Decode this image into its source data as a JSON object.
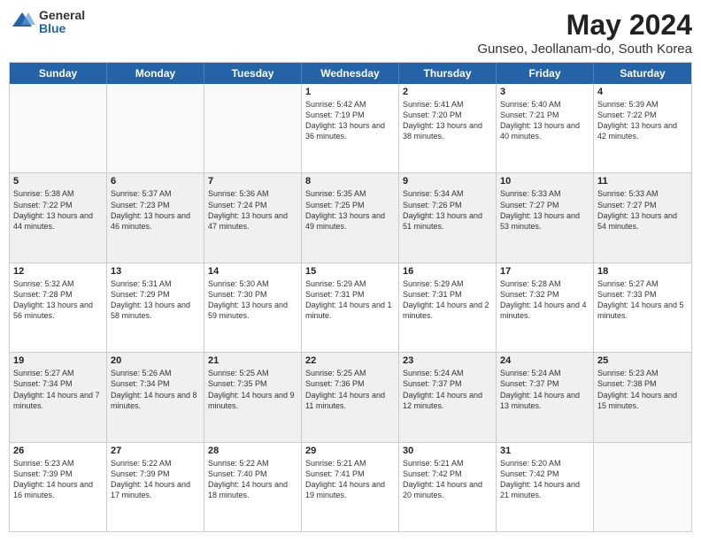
{
  "logo": {
    "general": "General",
    "blue": "Blue"
  },
  "header": {
    "month": "May 2024",
    "location": "Gunseo, Jeollanam-do, South Korea"
  },
  "days": [
    "Sunday",
    "Monday",
    "Tuesday",
    "Wednesday",
    "Thursday",
    "Friday",
    "Saturday"
  ],
  "rows": [
    [
      {
        "day": "",
        "empty": true
      },
      {
        "day": "",
        "empty": true
      },
      {
        "day": "",
        "empty": true
      },
      {
        "day": "1",
        "sunrise": "5:42 AM",
        "sunset": "7:19 PM",
        "daylight": "13 hours and 36 minutes."
      },
      {
        "day": "2",
        "sunrise": "5:41 AM",
        "sunset": "7:20 PM",
        "daylight": "13 hours and 38 minutes."
      },
      {
        "day": "3",
        "sunrise": "5:40 AM",
        "sunset": "7:21 PM",
        "daylight": "13 hours and 40 minutes."
      },
      {
        "day": "4",
        "sunrise": "5:39 AM",
        "sunset": "7:22 PM",
        "daylight": "13 hours and 42 minutes."
      }
    ],
    [
      {
        "day": "5",
        "sunrise": "5:38 AM",
        "sunset": "7:22 PM",
        "daylight": "13 hours and 44 minutes."
      },
      {
        "day": "6",
        "sunrise": "5:37 AM",
        "sunset": "7:23 PM",
        "daylight": "13 hours and 46 minutes."
      },
      {
        "day": "7",
        "sunrise": "5:36 AM",
        "sunset": "7:24 PM",
        "daylight": "13 hours and 47 minutes."
      },
      {
        "day": "8",
        "sunrise": "5:35 AM",
        "sunset": "7:25 PM",
        "daylight": "13 hours and 49 minutes."
      },
      {
        "day": "9",
        "sunrise": "5:34 AM",
        "sunset": "7:26 PM",
        "daylight": "13 hours and 51 minutes."
      },
      {
        "day": "10",
        "sunrise": "5:33 AM",
        "sunset": "7:27 PM",
        "daylight": "13 hours and 53 minutes."
      },
      {
        "day": "11",
        "sunrise": "5:33 AM",
        "sunset": "7:27 PM",
        "daylight": "13 hours and 54 minutes."
      }
    ],
    [
      {
        "day": "12",
        "sunrise": "5:32 AM",
        "sunset": "7:28 PM",
        "daylight": "13 hours and 56 minutes."
      },
      {
        "day": "13",
        "sunrise": "5:31 AM",
        "sunset": "7:29 PM",
        "daylight": "13 hours and 58 minutes."
      },
      {
        "day": "14",
        "sunrise": "5:30 AM",
        "sunset": "7:30 PM",
        "daylight": "13 hours and 59 minutes."
      },
      {
        "day": "15",
        "sunrise": "5:29 AM",
        "sunset": "7:31 PM",
        "daylight": "14 hours and 1 minute."
      },
      {
        "day": "16",
        "sunrise": "5:29 AM",
        "sunset": "7:31 PM",
        "daylight": "14 hours and 2 minutes."
      },
      {
        "day": "17",
        "sunrise": "5:28 AM",
        "sunset": "7:32 PM",
        "daylight": "14 hours and 4 minutes."
      },
      {
        "day": "18",
        "sunrise": "5:27 AM",
        "sunset": "7:33 PM",
        "daylight": "14 hours and 5 minutes."
      }
    ],
    [
      {
        "day": "19",
        "sunrise": "5:27 AM",
        "sunset": "7:34 PM",
        "daylight": "14 hours and 7 minutes."
      },
      {
        "day": "20",
        "sunrise": "5:26 AM",
        "sunset": "7:34 PM",
        "daylight": "14 hours and 8 minutes."
      },
      {
        "day": "21",
        "sunrise": "5:25 AM",
        "sunset": "7:35 PM",
        "daylight": "14 hours and 9 minutes."
      },
      {
        "day": "22",
        "sunrise": "5:25 AM",
        "sunset": "7:36 PM",
        "daylight": "14 hours and 11 minutes."
      },
      {
        "day": "23",
        "sunrise": "5:24 AM",
        "sunset": "7:37 PM",
        "daylight": "14 hours and 12 minutes."
      },
      {
        "day": "24",
        "sunrise": "5:24 AM",
        "sunset": "7:37 PM",
        "daylight": "14 hours and 13 minutes."
      },
      {
        "day": "25",
        "sunrise": "5:23 AM",
        "sunset": "7:38 PM",
        "daylight": "14 hours and 15 minutes."
      }
    ],
    [
      {
        "day": "26",
        "sunrise": "5:23 AM",
        "sunset": "7:39 PM",
        "daylight": "14 hours and 16 minutes."
      },
      {
        "day": "27",
        "sunrise": "5:22 AM",
        "sunset": "7:39 PM",
        "daylight": "14 hours and 17 minutes."
      },
      {
        "day": "28",
        "sunrise": "5:22 AM",
        "sunset": "7:40 PM",
        "daylight": "14 hours and 18 minutes."
      },
      {
        "day": "29",
        "sunrise": "5:21 AM",
        "sunset": "7:41 PM",
        "daylight": "14 hours and 19 minutes."
      },
      {
        "day": "30",
        "sunrise": "5:21 AM",
        "sunset": "7:42 PM",
        "daylight": "14 hours and 20 minutes."
      },
      {
        "day": "31",
        "sunrise": "5:20 AM",
        "sunset": "7:42 PM",
        "daylight": "14 hours and 21 minutes."
      },
      {
        "day": "",
        "empty": true
      }
    ]
  ]
}
